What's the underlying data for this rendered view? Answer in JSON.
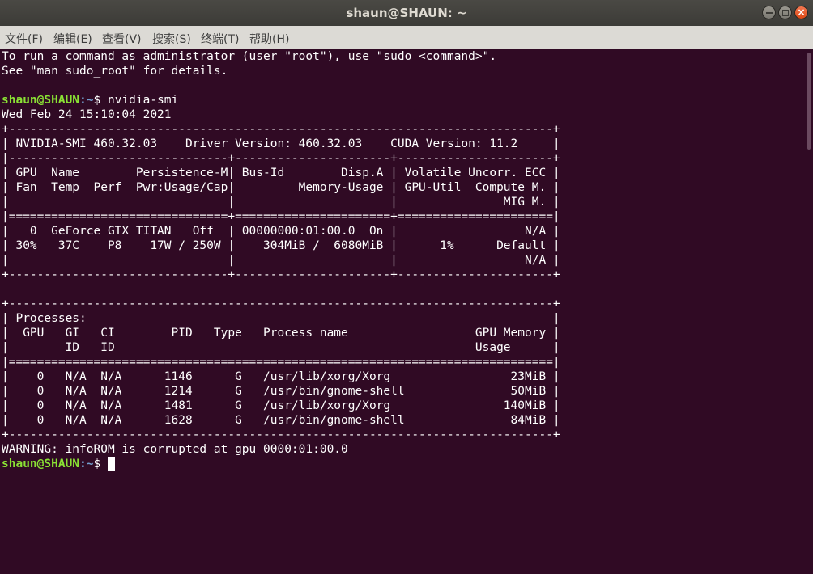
{
  "window": {
    "title": "shaun@SHAUN: ~",
    "controls": {
      "minimize": "minimize-icon",
      "maximize": "maximize-icon",
      "close": "close-icon"
    }
  },
  "menu": [
    "文件(F)",
    "编辑(E)",
    "查看(V)",
    "搜索(S)",
    "终端(T)",
    "帮助(H)"
  ],
  "prompt": {
    "user_host": "shaun@SHAUN",
    "path": ":~",
    "symbol": "$ ",
    "command": "nvidia-smi"
  },
  "lines": [
    "To run a command as administrator (user \"root\"), use \"sudo <command>\".",
    "See \"man sudo_root\" for details.",
    "",
    "__PROMPT_CMD__",
    "Wed Feb 24 15:10:04 2021",
    "+-----------------------------------------------------------------------------+",
    "| NVIDIA-SMI 460.32.03    Driver Version: 460.32.03    CUDA Version: 11.2     |",
    "|-------------------------------+----------------------+----------------------+",
    "| GPU  Name        Persistence-M| Bus-Id        Disp.A | Volatile Uncorr. ECC |",
    "| Fan  Temp  Perf  Pwr:Usage/Cap|         Memory-Usage | GPU-Util  Compute M. |",
    "|                               |                      |               MIG M. |",
    "|===============================+======================+======================|",
    "|   0  GeForce GTX TITAN   Off  | 00000000:01:00.0  On |                  N/A |",
    "| 30%   37C    P8    17W / 250W |    304MiB /  6080MiB |      1%      Default |",
    "|                               |                      |                  N/A |",
    "+-------------------------------+----------------------+----------------------+",
    "",
    "+-----------------------------------------------------------------------------+",
    "| Processes:                                                                  |",
    "|  GPU   GI   CI        PID   Type   Process name                  GPU Memory |",
    "|        ID   ID                                                   Usage      |",
    "|=============================================================================|",
    "|    0   N/A  N/A      1146      G   /usr/lib/xorg/Xorg                 23MiB |",
    "|    0   N/A  N/A      1214      G   /usr/bin/gnome-shell               50MiB |",
    "|    0   N/A  N/A      1481      G   /usr/lib/xorg/Xorg                140MiB |",
    "|    0   N/A  N/A      1628      G   /usr/bin/gnome-shell               84MiB |",
    "+-----------------------------------------------------------------------------+",
    "WARNING: infoROM is corrupted at gpu 0000:01:00.0",
    "__PROMPT_CURSOR__"
  ]
}
